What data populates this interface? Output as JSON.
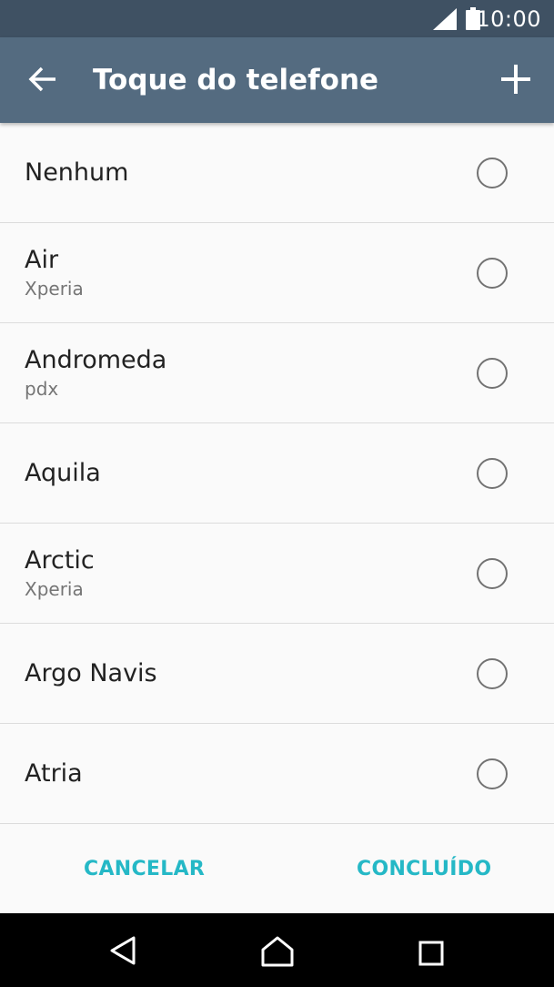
{
  "status_bar": {
    "time": "10:00",
    "icons": [
      "signal-icon",
      "battery-icon"
    ]
  },
  "app_bar": {
    "title": "Toque do telefone",
    "back_icon": "arrow-left",
    "add_icon": "plus"
  },
  "ringtones": [
    {
      "title": "Nenhum",
      "subtitle": ""
    },
    {
      "title": "Air",
      "subtitle": "Xperia"
    },
    {
      "title": "Andromeda",
      "subtitle": "pdx"
    },
    {
      "title": "Aquila",
      "subtitle": ""
    },
    {
      "title": "Arctic",
      "subtitle": "Xperia"
    },
    {
      "title": "Argo Navis",
      "subtitle": ""
    },
    {
      "title": "Atria",
      "subtitle": ""
    }
  ],
  "footer": {
    "cancel_label": "CANCELAR",
    "done_label": "CONCLUÍDO"
  },
  "colors": {
    "status_bar": "#3f5163",
    "app_bar": "#546b80",
    "accent": "#25b8c6",
    "nav_bar": "#000000"
  },
  "nav_bar": {
    "icons": [
      "back-triangle-icon",
      "home-icon",
      "recents-square-icon"
    ]
  }
}
